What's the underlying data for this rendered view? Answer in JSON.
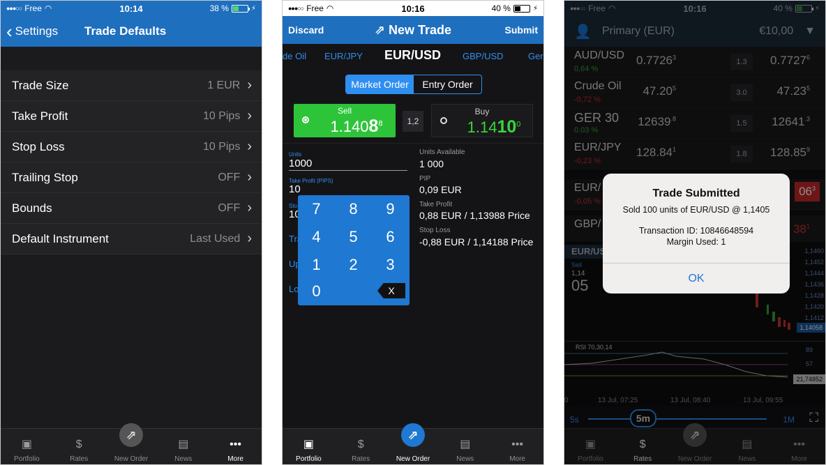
{
  "screen1": {
    "status": {
      "carrier": "Free",
      "time": "10:14",
      "battery": "38 %"
    },
    "nav": {
      "back": "Settings",
      "title": "Trade Defaults"
    },
    "rows": [
      {
        "label": "Trade Size",
        "value": "1 EUR"
      },
      {
        "label": "Take Profit",
        "value": "10 Pips"
      },
      {
        "label": "Stop Loss",
        "value": "10 Pips"
      },
      {
        "label": "Trailing Stop",
        "value": "OFF"
      },
      {
        "label": "Bounds",
        "value": "OFF"
      },
      {
        "label": "Default Instrument",
        "value": "Last Used"
      }
    ]
  },
  "screen2": {
    "status": {
      "carrier": "Free",
      "time": "10:16",
      "battery": "40 %"
    },
    "nav": {
      "discard": "Discard",
      "title": "New Trade",
      "submit": "Submit"
    },
    "pairs": {
      "p1": "de Oil",
      "p2": "EUR/JPY",
      "selected": "EUR/USD",
      "p4": "GBP/USD",
      "p5": "Ger"
    },
    "segment": {
      "market": "Market Order",
      "entry": "Entry Order"
    },
    "sell": {
      "label": "Sell",
      "main": "1.140",
      "big": "8",
      "sup": "8"
    },
    "buy": {
      "label": "Buy",
      "main": "1.14",
      "big": "10",
      "sup": "0"
    },
    "spread": "1,2",
    "form": {
      "units_label": "Units",
      "units_value": "1000",
      "tp_label": "Take Profit (PIPS)",
      "tp_value": "10",
      "sl_label": "Sto",
      "sl_value": "10",
      "link1": "Tra",
      "link2": "Up",
      "link3": "Lo",
      "units_avail_label": "Units Available",
      "units_avail_value": "1 000",
      "pip_label": "PIP",
      "pip_value": "0,09 EUR",
      "tp_info_label": "Take Profit",
      "tp_info_value": "0,88 EUR / 1,13988 Price",
      "sl_info_label": "Stop Loss",
      "sl_info_value": "-0,88 EUR / 1,14188 Price"
    },
    "keys": [
      "7",
      "8",
      "9",
      "4",
      "5",
      "6",
      "1",
      "2",
      "3",
      "0"
    ],
    "del": "X"
  },
  "screen3": {
    "status": {
      "carrier": "Free",
      "time": "10:16",
      "battery": "40 %"
    },
    "account": {
      "name": "Primary (EUR)",
      "balance": "€10,00"
    },
    "rates": [
      {
        "name": "AUD/USD",
        "chg": "0,64 %",
        "bid": "0.7726",
        "bid_sup": "3",
        "spr": "1.3",
        "ask": "0.7727",
        "ask_sup": "6"
      },
      {
        "name": "Crude Oil",
        "chg": "-0,72 %",
        "bid": "47.20",
        "bid_sup": "5",
        "spr": "3.0",
        "ask": "47.23",
        "ask_sup": "5"
      },
      {
        "name": "GER 30",
        "chg": "0.03 %",
        "bid": "12639",
        "bid_sup": ".8",
        "spr": "1.5",
        "ask": "12641",
        "ask_sup": ".3"
      },
      {
        "name": "EUR/JPY",
        "chg": "-0,23 %",
        "bid": "128.84",
        "bid_sup": "1",
        "spr": "1.8",
        "ask": "128.85",
        "ask_sup": "9"
      },
      {
        "name": "EUR/",
        "chg": "-0,05 %",
        "bid": "",
        "bid_sup": "",
        "spr": "",
        "ask": "06",
        "ask_sup": "3"
      },
      {
        "name": "GBP/",
        "chg": "",
        "bid": "",
        "bid_sup": "",
        "spr": "",
        "ask": "38",
        "ask_sup": "1"
      }
    ],
    "chart": {
      "pair": "EUR/USD",
      "sell_label": "Sell",
      "sell_small": "1,14",
      "sell_big": "05",
      "ticks": [
        "1,1460",
        "1,1452",
        "1,1444",
        "1,1436",
        "1,1428",
        "1,1420",
        "1,1412"
      ],
      "last_price": "1,14058",
      "rsi_label": "RSI 70,30,14",
      "rsi_ticks": [
        "89",
        "57"
      ],
      "rsi_value": "21,74852",
      "times": [
        "0",
        "13 Jul, 07:25",
        "13 Jul, 08:40",
        "13 Jul, 09:55"
      ]
    },
    "timeframe": {
      "min": "5s",
      "current": "5m",
      "max": "1M"
    },
    "alert": {
      "title": "Trade Submitted",
      "line1": "Sold 100 units of EUR/USD @ 1,1405",
      "line2": "Transaction ID: 10846648594",
      "line3": "Margin Used: 1",
      "ok": "OK"
    }
  },
  "tabs": [
    "Portfolio",
    "Rates",
    "New Order",
    "News",
    "More"
  ]
}
